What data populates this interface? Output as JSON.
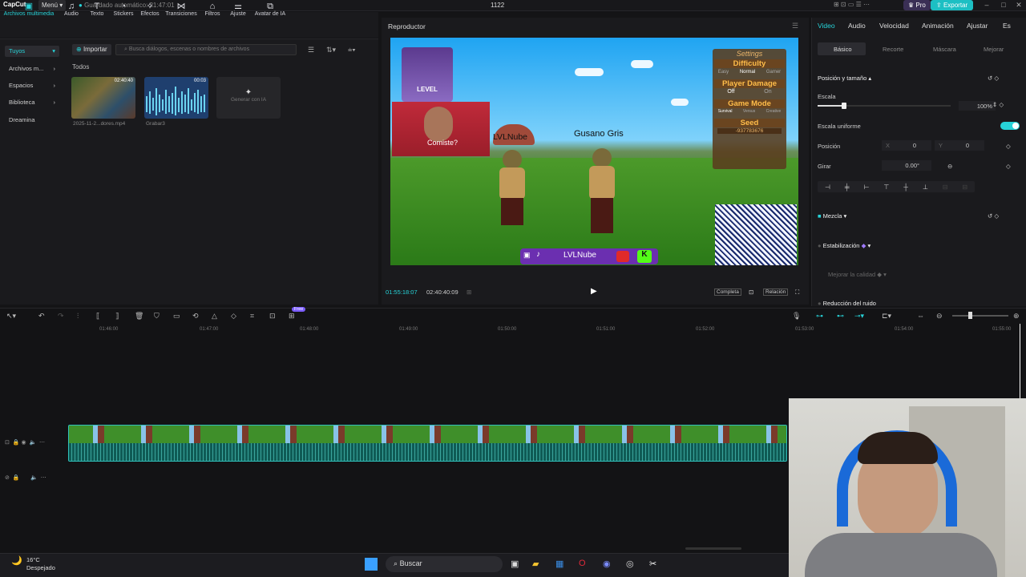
{
  "titlebar": {
    "app": "CapCut",
    "menu": "Menú",
    "autosave": "Guardado automático: 21:47:01",
    "project": "1122",
    "pro": "Pro",
    "export": "Exportar"
  },
  "toolbar": [
    {
      "label": "Archivos multimedia",
      "icon": "media-icon",
      "active": true
    },
    {
      "label": "Audio",
      "icon": "audio-icon"
    },
    {
      "label": "Texto",
      "icon": "text-icon"
    },
    {
      "label": "Stickers",
      "icon": "sticker-icon"
    },
    {
      "label": "Efectos",
      "icon": "effects-icon"
    },
    {
      "label": "Transiciones",
      "icon": "transition-icon"
    },
    {
      "label": "Filtros",
      "icon": "filter-icon"
    },
    {
      "label": "Ajuste",
      "icon": "adjust-icon"
    },
    {
      "label": "Avatar de IA",
      "icon": "avatar-icon"
    }
  ],
  "media": {
    "side": [
      "Tuyos",
      "Archivos m...",
      "Espacios",
      "Biblioteca",
      "Dreamina"
    ],
    "import": "Importar",
    "search_placeholder": "Busca diálogos, escenas o nombres de archivos",
    "filter_all": "Todos",
    "items": [
      {
        "name": "2025-11-2...dores.mp4",
        "duration": "02:40:40"
      },
      {
        "name": "Grabar3",
        "duration": "00:03"
      }
    ],
    "ai_generate": "Generar con IA"
  },
  "player": {
    "title": "Reproductor",
    "current_time": "01:55:18:07",
    "total_time": "02:40:40:09",
    "full_label": "Completa",
    "ratio_label": "Relación",
    "overlay": {
      "level": "LEVEL",
      "comiste": "Comiste?",
      "npc1": "LVLNube",
      "npc2": "Gusano Gris",
      "settings_title": "Settings",
      "difficulty": "Difficulty",
      "diff_opts": [
        "Easy",
        "Normal",
        "Gamer"
      ],
      "player_damage": "Player Damage",
      "damage_opts": [
        "Off",
        "On"
      ],
      "game_mode": "Game Mode",
      "mode_opts": [
        "Survival",
        "Versus",
        "Creative"
      ],
      "seed": "Seed",
      "seed_value": "-937783676",
      "banner": "LVLNube"
    }
  },
  "inspector": {
    "tabs": [
      "Video",
      "Audio",
      "Velocidad",
      "Animación",
      "Ajustar",
      "Es"
    ],
    "subtabs": [
      "Básico",
      "Recorte",
      "Máscara",
      "Mejorar"
    ],
    "section_pos": "Posición y tamaño",
    "scale_label": "Escala",
    "scale_value": "100%",
    "scale_fraction": 0.2,
    "uniform_label": "Escala uniforme",
    "position_label": "Posición",
    "x_label": "X",
    "x_value": "0",
    "y_label": "Y",
    "y_value": "0",
    "rotate_label": "Girar",
    "rotate_value": "0.00°",
    "blend_label": "Mezcla",
    "stab_label": "Estabilización",
    "improve_label": "Mejorar la calidad",
    "noise_label": "Reducción del ruido"
  },
  "timeline": {
    "free_badge": "Free",
    "ticks": [
      "01:46:00",
      "01:47:00",
      "01:48:00",
      "01:49:00",
      "01:50:00",
      "01:51:00",
      "01:52:00",
      "01:53:00",
      "01:54:00",
      "01:55:00"
    ]
  },
  "taskbar": {
    "temp": "16°C",
    "weather": "Despejado",
    "search": "Buscar"
  },
  "colors": {
    "accent": "#27d3d8",
    "export": "#1dbfc3",
    "track": "#0f5b55"
  }
}
